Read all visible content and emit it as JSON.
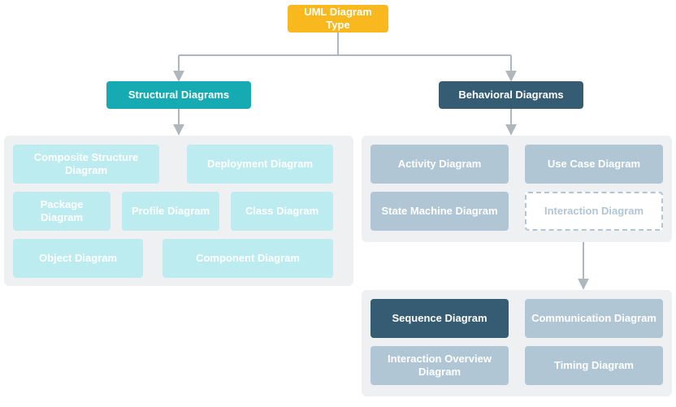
{
  "root": {
    "label": "UML Diagram Type"
  },
  "structural": {
    "label": "Structural Diagrams",
    "items": {
      "composite": "Composite Structure Diagram",
      "deployment": "Deployment Diagram",
      "package": "Package Diagram",
      "profile": "Profile Diagram",
      "class": "Class Diagram",
      "object": "Object Diagram",
      "component": "Component Diagram"
    }
  },
  "behavioral": {
    "label": "Behavioral Diagrams",
    "items": {
      "activity": "Activity Diagram",
      "usecase": "Use Case Diagram",
      "statemachine": "State Machine Diagram",
      "interaction": "Interaction Diagram"
    },
    "interaction_children": {
      "sequence": "Sequence Diagram",
      "communication": "Communication Diagram",
      "overview": "Interaction Overview Diagram",
      "timing": "Timing Diagram"
    }
  }
}
